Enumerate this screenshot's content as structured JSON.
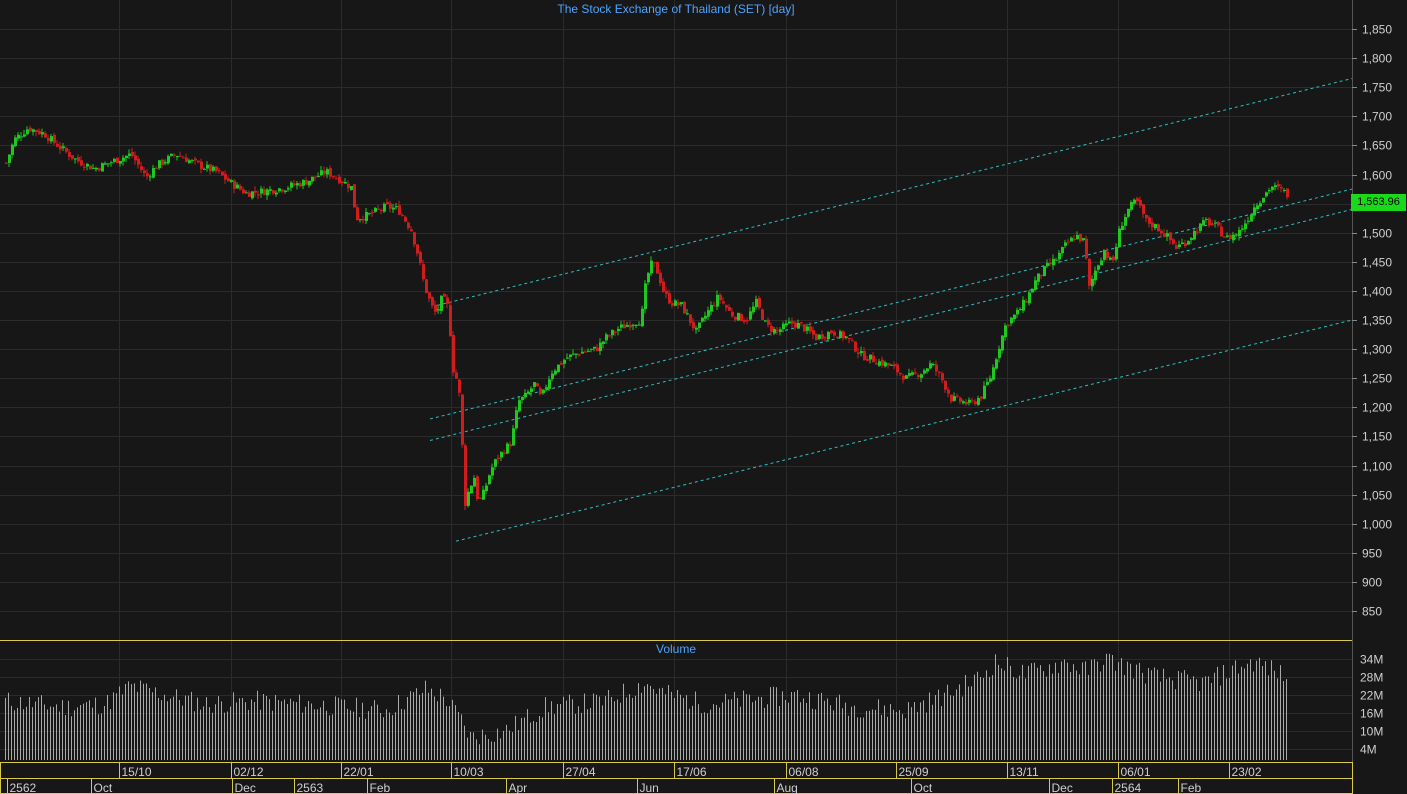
{
  "chart_data": [
    {
      "type": "candlestick",
      "title": "The Stock Exchange of Thailand (SET) [day]",
      "last_price_label": "1,563.96",
      "y_ticks": [
        850,
        900,
        950,
        1000,
        1050,
        1100,
        1150,
        1200,
        1250,
        1300,
        1350,
        1400,
        1450,
        1500,
        1550,
        1600,
        1650,
        1700,
        1750,
        1800,
        1850
      ],
      "ylim": [
        800,
        1890
      ],
      "grid": true,
      "series_anchor_points": [
        [
          0,
          1620
        ],
        [
          8,
          1660
        ],
        [
          22,
          1680
        ],
        [
          38,
          1670
        ],
        [
          55,
          1645
        ],
        [
          70,
          1625
        ],
        [
          88,
          1610
        ],
        [
          110,
          1625
        ],
        [
          125,
          1635
        ],
        [
          140,
          1595
        ],
        [
          150,
          1615
        ],
        [
          170,
          1635
        ],
        [
          190,
          1618
        ],
        [
          210,
          1605
        ],
        [
          225,
          1585
        ],
        [
          240,
          1568
        ],
        [
          260,
          1572
        ],
        [
          280,
          1578
        ],
        [
          300,
          1588
        ],
        [
          320,
          1605
        ],
        [
          335,
          1590
        ],
        [
          345,
          1578
        ],
        [
          350,
          1525
        ],
        [
          362,
          1530
        ],
        [
          380,
          1545
        ],
        [
          392,
          1540
        ],
        [
          405,
          1505
        ],
        [
          412,
          1460
        ],
        [
          418,
          1410
        ],
        [
          425,
          1375
        ],
        [
          430,
          1360
        ],
        [
          436,
          1390
        ],
        [
          442,
          1370
        ],
        [
          447,
          1265
        ],
        [
          452,
          1240
        ],
        [
          455,
          1185
        ],
        [
          458,
          1030
        ],
        [
          463,
          1060
        ],
        [
          468,
          1080
        ],
        [
          472,
          1035
        ],
        [
          478,
          1055
        ],
        [
          484,
          1090
        ],
        [
          490,
          1110
        ],
        [
          497,
          1125
        ],
        [
          505,
          1140
        ],
        [
          512,
          1210
        ],
        [
          520,
          1220
        ],
        [
          528,
          1240
        ],
        [
          535,
          1215
        ],
        [
          545,
          1260
        ],
        [
          560,
          1285
        ],
        [
          575,
          1295
        ],
        [
          590,
          1300
        ],
        [
          600,
          1320
        ],
        [
          612,
          1335
        ],
        [
          625,
          1345
        ],
        [
          635,
          1350
        ],
        [
          640,
          1420
        ],
        [
          646,
          1450
        ],
        [
          652,
          1430
        ],
        [
          658,
          1395
        ],
        [
          665,
          1380
        ],
        [
          675,
          1375
        ],
        [
          690,
          1330
        ],
        [
          700,
          1360
        ],
        [
          712,
          1390
        ],
        [
          725,
          1360
        ],
        [
          740,
          1350
        ],
        [
          750,
          1380
        ],
        [
          760,
          1340
        ],
        [
          770,
          1330
        ],
        [
          785,
          1345
        ],
        [
          795,
          1340
        ],
        [
          810,
          1320
        ],
        [
          825,
          1330
        ],
        [
          840,
          1320
        ],
        [
          855,
          1290
        ],
        [
          870,
          1280
        ],
        [
          885,
          1270
        ],
        [
          900,
          1250
        ],
        [
          915,
          1260
        ],
        [
          925,
          1275
        ],
        [
          935,
          1250
        ],
        [
          945,
          1215
        ],
        [
          955,
          1210
        ],
        [
          965,
          1205
        ],
        [
          975,
          1220
        ],
        [
          985,
          1255
        ],
        [
          992,
          1300
        ],
        [
          1000,
          1345
        ],
        [
          1010,
          1360
        ],
        [
          1020,
          1385
        ],
        [
          1030,
          1420
        ],
        [
          1040,
          1440
        ],
        [
          1050,
          1455
        ],
        [
          1060,
          1480
        ],
        [
          1070,
          1495
        ],
        [
          1078,
          1485
        ],
        [
          1083,
          1405
        ],
        [
          1090,
          1440
        ],
        [
          1098,
          1470
        ],
        [
          1106,
          1445
        ],
        [
          1114,
          1510
        ],
        [
          1122,
          1540
        ],
        [
          1130,
          1555
        ],
        [
          1140,
          1520
        ],
        [
          1150,
          1510
        ],
        [
          1160,
          1495
        ],
        [
          1170,
          1475
        ],
        [
          1180,
          1485
        ],
        [
          1190,
          1505
        ],
        [
          1200,
          1520
        ],
        [
          1210,
          1510
        ],
        [
          1220,
          1490
        ],
        [
          1232,
          1500
        ],
        [
          1240,
          1520
        ],
        [
          1250,
          1550
        ],
        [
          1258,
          1565
        ],
        [
          1265,
          1580
        ],
        [
          1272,
          1575
        ],
        [
          1280,
          1568
        ],
        [
          1282,
          1564
        ]
      ],
      "trend_lines": [
        [
          437,
          1375,
          1352,
          1765
        ],
        [
          430,
          1180,
          1352,
          1575
        ],
        [
          430,
          1143,
          1352,
          1540
        ],
        [
          456,
          970,
          1352,
          1350
        ]
      ],
      "x_labels_row1": [
        {
          "text": "15/10",
          "day": 114
        },
        {
          "text": "02/12",
          "day": 226
        },
        {
          "text": "22/01",
          "day": 336
        },
        {
          "text": "10/03",
          "day": 446
        },
        {
          "text": "27/04",
          "day": 558
        },
        {
          "text": "17/06",
          "day": 669
        },
        {
          "text": "06/08",
          "day": 781
        },
        {
          "text": "25/09",
          "day": 891
        },
        {
          "text": "13/11",
          "day": 1002
        },
        {
          "text": "06/01",
          "day": 1113
        },
        {
          "text": "23/02",
          "day": 1224
        }
      ],
      "x_labels_row2": [
        {
          "text": "2562",
          "day": 2
        },
        {
          "text": "Oct",
          "day": 86
        },
        {
          "text": "Dec",
          "day": 227
        },
        {
          "text": "2563",
          "day": 289
        },
        {
          "text": "Feb",
          "day": 362
        },
        {
          "text": "Apr",
          "day": 501
        },
        {
          "text": "Jun",
          "day": 632
        },
        {
          "text": "Aug",
          "day": 769
        },
        {
          "text": "Oct",
          "day": 906
        },
        {
          "text": "Dec",
          "day": 1044
        },
        {
          "text": "2564",
          "day": 1107
        },
        {
          "text": "Feb",
          "day": 1173
        }
      ]
    },
    {
      "type": "bar",
      "title": "Volume",
      "unit": "M",
      "y_ticks": [
        "4M",
        "10M",
        "16M",
        "22M",
        "28M",
        "34M"
      ],
      "y_tick_values": [
        4,
        10,
        16,
        22,
        28,
        34
      ],
      "ylim": [
        0,
        37
      ],
      "volume_anchor_points": [
        [
          0,
          20
        ],
        [
          60,
          18
        ],
        [
          100,
          19
        ],
        [
          125,
          25
        ],
        [
          160,
          22
        ],
        [
          200,
          19
        ],
        [
          250,
          20
        ],
        [
          300,
          19
        ],
        [
          340,
          18
        ],
        [
          380,
          17
        ],
        [
          410,
          22
        ],
        [
          420,
          24
        ],
        [
          440,
          21
        ],
        [
          455,
          14
        ],
        [
          465,
          8
        ],
        [
          500,
          10
        ],
        [
          540,
          18
        ],
        [
          600,
          20
        ],
        [
          640,
          26
        ],
        [
          655,
          23
        ],
        [
          700,
          19
        ],
        [
          790,
          22
        ],
        [
          850,
          18
        ],
        [
          900,
          17
        ],
        [
          940,
          22
        ],
        [
          975,
          28
        ],
        [
          990,
          33
        ],
        [
          1020,
          29
        ],
        [
          1060,
          33
        ],
        [
          1080,
          30
        ],
        [
          1100,
          34
        ],
        [
          1150,
          28
        ],
        [
          1200,
          26
        ],
        [
          1230,
          31
        ],
        [
          1250,
          33
        ],
        [
          1282,
          28
        ]
      ]
    }
  ]
}
